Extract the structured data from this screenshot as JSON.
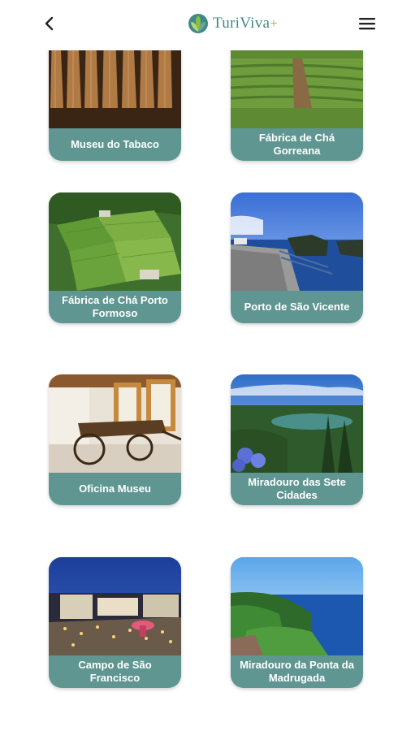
{
  "header": {
    "back_icon": "chevron-left-icon",
    "logo_text": "TuriViva",
    "logo_plus": "+",
    "menu_icon": "hamburger-menu-icon"
  },
  "places": [
    {
      "name": "Museu do Tabaco"
    },
    {
      "name": "Fábrica de Chá Gorreana"
    },
    {
      "name": "Fábrica de Chá Porto Formoso"
    },
    {
      "name": "Porto de São Vicente"
    },
    {
      "name": "Oficina Museu"
    },
    {
      "name": "Miradouro das Sete Cidades"
    },
    {
      "name": "Campo de São Francisco"
    },
    {
      "name": "Miradouro da Ponta da Madrugada"
    }
  ],
  "colors": {
    "card_label_bg": "#5f9691",
    "brand_teal": "#3f8a86",
    "brand_green": "#8cbf3f"
  }
}
